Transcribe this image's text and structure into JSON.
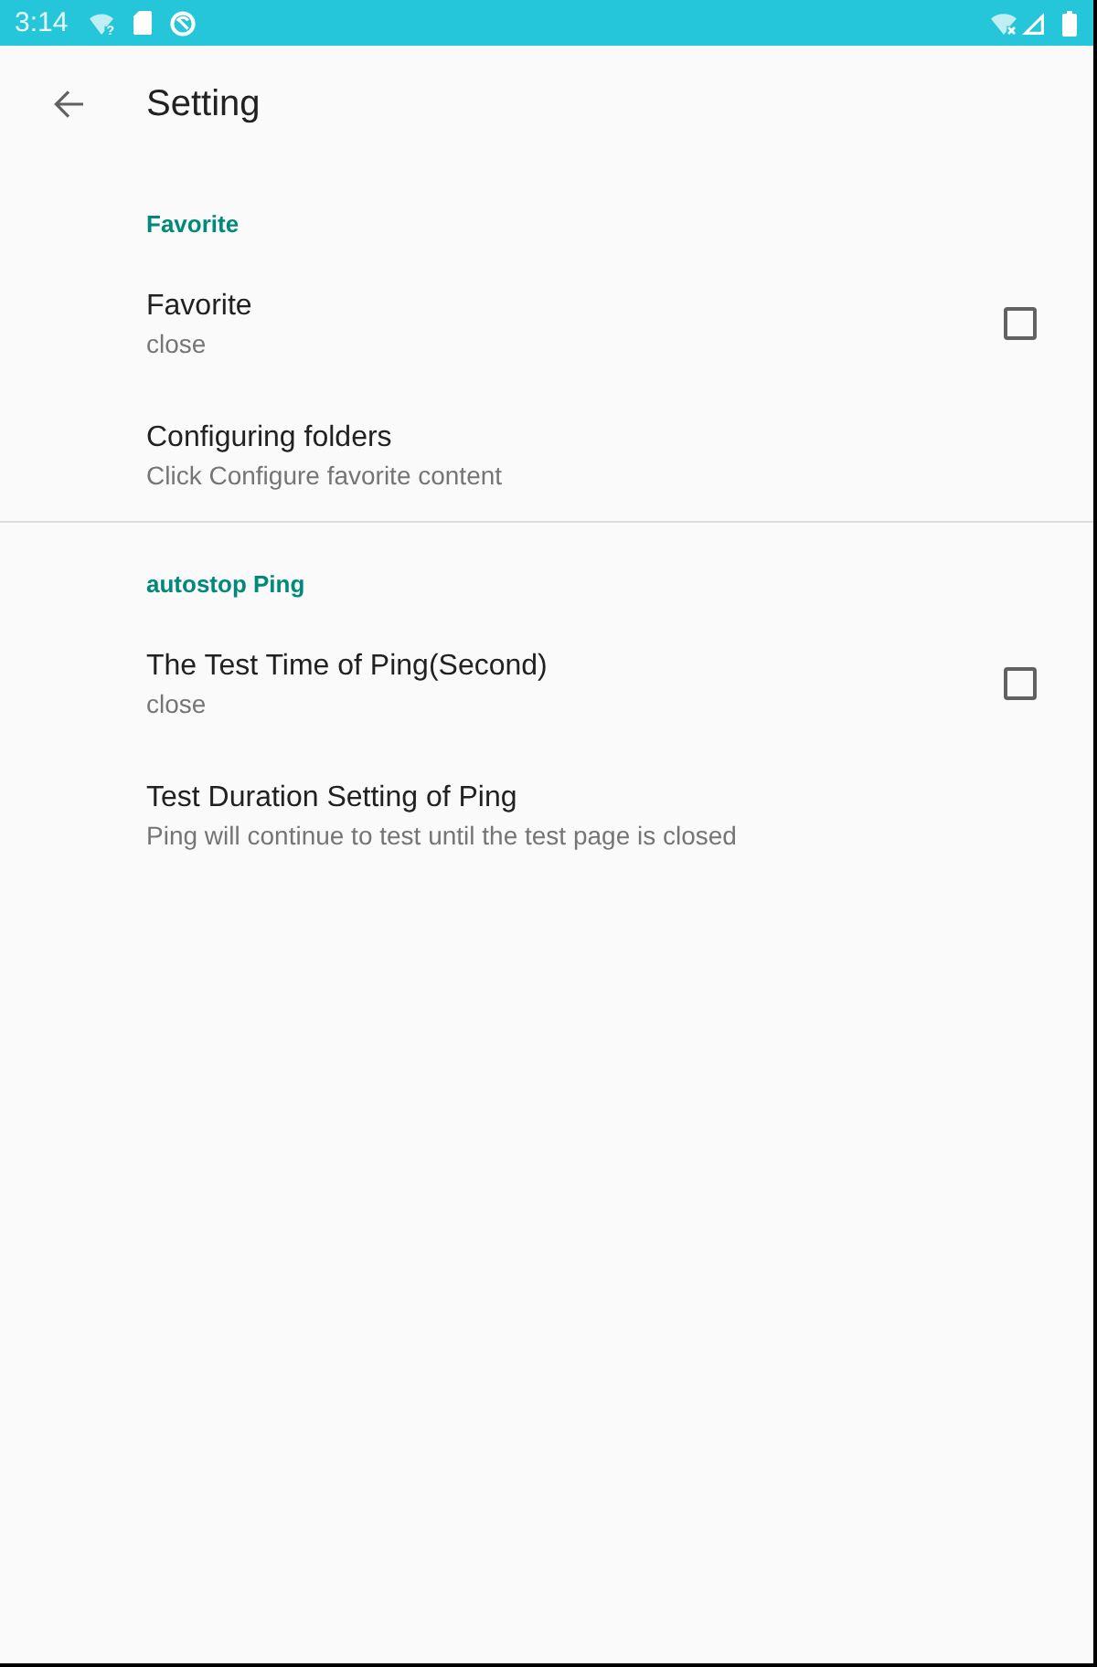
{
  "status_bar": {
    "time": "3:14",
    "wifi_badge": "?"
  },
  "toolbar": {
    "title": "Setting"
  },
  "categories": [
    {
      "title": "Favorite",
      "items": [
        {
          "kind": "checkbox",
          "title": "Favorite",
          "summary": "close",
          "checked": false
        },
        {
          "kind": "plain",
          "title": "Configuring folders",
          "summary": "Click Configure favorite content"
        }
      ]
    },
    {
      "title": "autostop Ping",
      "items": [
        {
          "kind": "checkbox",
          "title": "The Test Time of Ping(Second)",
          "summary": "close",
          "checked": false
        },
        {
          "kind": "plain",
          "title": "Test Duration Setting of Ping",
          "summary": "Ping will continue to test until the test page is closed"
        }
      ]
    }
  ]
}
